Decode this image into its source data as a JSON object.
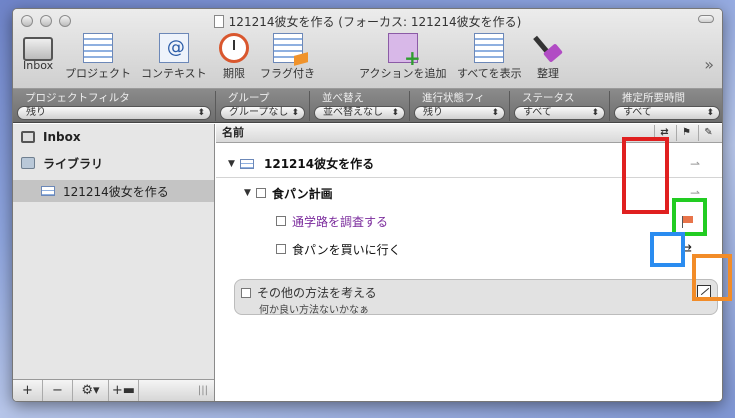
{
  "window": {
    "title": "121214彼女を作る (フォーカス: 121214彼女を作る)"
  },
  "toolbar": {
    "items": [
      {
        "label": "Inbox",
        "icon": "inbox-icon"
      },
      {
        "label": "プロジェクト",
        "icon": "project-icon"
      },
      {
        "label": "コンテキスト",
        "icon": "context-icon"
      },
      {
        "label": "期限",
        "icon": "clock-icon"
      },
      {
        "label": "フラグ付き",
        "icon": "flag-icon"
      },
      {
        "label": "アクションを追加",
        "icon": "add-action-icon"
      },
      {
        "label": "すべてを表示",
        "icon": "show-all-icon"
      },
      {
        "label": "整理",
        "icon": "broom-icon"
      }
    ],
    "more": "»"
  },
  "filters": [
    {
      "label": "プロジェクトフィルタ",
      "value": "残り"
    },
    {
      "label": "グループ",
      "value": "グループなし"
    },
    {
      "label": "並べ替え",
      "value": "並べ替えなし"
    },
    {
      "label": "進行状態フィ",
      "value": "残り"
    },
    {
      "label": "ステータス",
      "value": "すべて"
    },
    {
      "label": "推定所要時間",
      "value": "すべて"
    }
  ],
  "sidebar": {
    "inbox": "Inbox",
    "library": "ライブラリ",
    "project": "121214彼女を作る",
    "bottom_buttons": [
      "+",
      "−",
      "⚙▾",
      "+▬"
    ]
  },
  "outline": {
    "column_header": "名前",
    "project": "121214彼女を作る",
    "group": "食パン計画",
    "task1": "通学路を調査する",
    "task2": "食パンを買いに行く",
    "task3": "その他の方法を考える",
    "task3_note": "何か良い方法ないかなぁ"
  },
  "colors": {
    "annotation_red": "#e02020",
    "annotation_green": "#22cc22",
    "annotation_blue": "#2a8cf0",
    "annotation_orange": "#f28c28",
    "flagged_text": "#7a2a9c"
  }
}
